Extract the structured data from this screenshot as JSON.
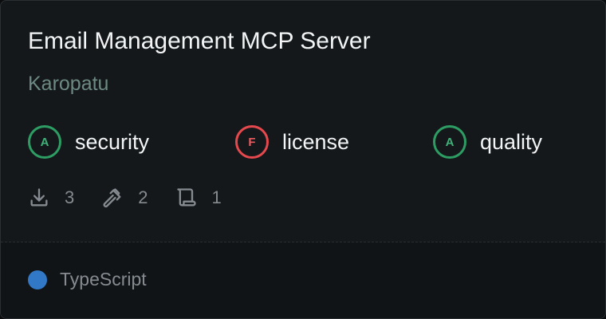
{
  "server": {
    "title": "Email Management MCP Server",
    "author": "Karopatu"
  },
  "scores": [
    {
      "grade": "A",
      "label": "security",
      "status_color": "#2d9d64"
    },
    {
      "grade": "F",
      "label": "license",
      "status_color": "#e5484d"
    },
    {
      "grade": "A",
      "label": "quality",
      "status_color": "#2d9d64"
    }
  ],
  "stats": {
    "downloads": "3",
    "tools": "2",
    "resources": "1",
    "icons": [
      "download-icon",
      "hammer-icon",
      "scroll-icon"
    ]
  },
  "language": {
    "name": "TypeScript",
    "color": "#3178c6"
  }
}
